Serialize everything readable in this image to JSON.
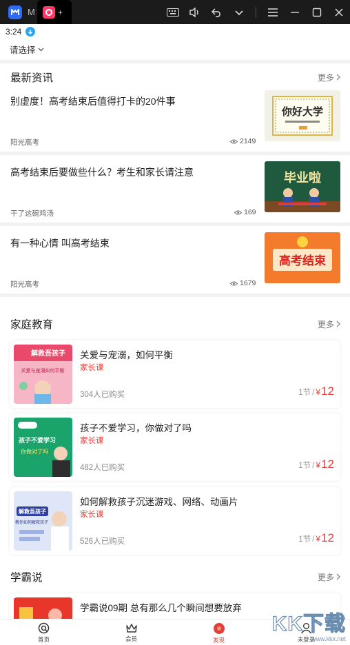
{
  "window": {
    "app_letter": "M",
    "tab_text": "+"
  },
  "status": {
    "time": "3:24"
  },
  "location": {
    "label": "请选择"
  },
  "news_section": {
    "title": "最新资讯",
    "more": "更多",
    "items": [
      {
        "headline": "别虚度！高考结束后值得打卡的20件事",
        "source": "阳光高考",
        "views": "2149",
        "thumb_text": "你好大学"
      },
      {
        "headline": "高考结束后要做些什么？考生和家长请注意",
        "source": "干了这碗鸡汤",
        "views": "169",
        "thumb_text": "毕业啦"
      },
      {
        "headline": "有一种心情 叫高考结束",
        "source": "阳光高考",
        "views": "1679",
        "thumb_text": "高考结束"
      }
    ]
  },
  "family_section": {
    "title": "家庭教育",
    "more": "更多",
    "courses": [
      {
        "title": "关爱与宠溺，如何平衡",
        "tag": "家长课",
        "bought": "304人已购买",
        "lessons": "1节",
        "slash": "/",
        "currency": "¥",
        "price": "12",
        "cover_text": "解救吾孩子",
        "cover_sub": "关爱与宠溺如何平衡"
      },
      {
        "title": "孩子不爱学习，你做对了吗",
        "tag": "家长课",
        "bought": "482人已购买",
        "lessons": "1节",
        "slash": "/",
        "currency": "¥",
        "price": "12",
        "cover_text": "孩子不爱学习",
        "cover_sub": "你做对了吗"
      },
      {
        "title": "如何解救孩子沉迷游戏、网络、动画片",
        "tag": "家长课",
        "bought": "526人已购买",
        "lessons": "1节",
        "slash": "/",
        "currency": "¥",
        "price": "12",
        "cover_text": "解救吾孩子",
        "cover_sub": "教你如何解救孩子"
      }
    ]
  },
  "xueba_section": {
    "title": "学霸说",
    "more": "更多",
    "courses": [
      {
        "title": "学霸说09期 总有那么几个瞬间想要放弃"
      }
    ]
  },
  "tabbar": {
    "items": [
      {
        "label": "首页",
        "icon": "home-icon"
      },
      {
        "label": "会员",
        "icon": "crown-icon"
      },
      {
        "label": "发现",
        "icon": "discover-icon",
        "active": true
      },
      {
        "label": "未登录",
        "icon": "user-icon"
      }
    ]
  },
  "watermark": {
    "text": "KK下载",
    "domain": "www.kkx.net"
  },
  "colors": {
    "accent": "#e0403a",
    "divider": "#f1f1f1",
    "titlebar": "#1b1b1b"
  }
}
